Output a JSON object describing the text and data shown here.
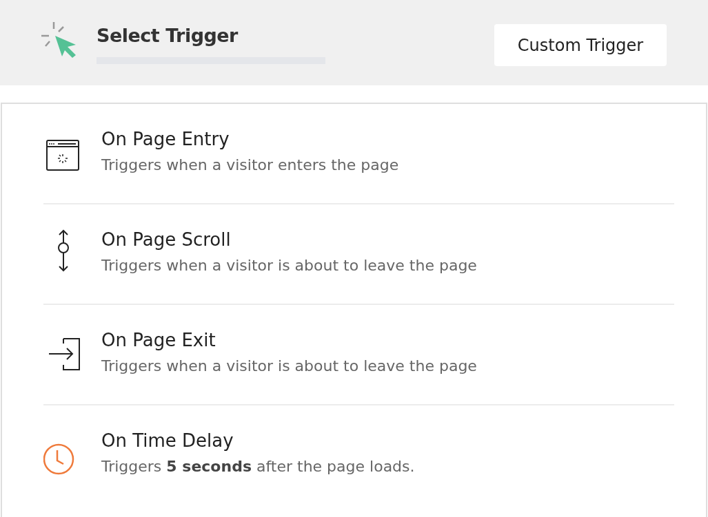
{
  "header": {
    "title": "Select Trigger",
    "button": "Custom Trigger"
  },
  "triggers": [
    {
      "kind": "entry",
      "title": "On Page Entry",
      "description": "Triggers when a visitor enters the page"
    },
    {
      "kind": "scroll",
      "title": "On Page Scroll",
      "description": "Triggers when a visitor is about to leave the page"
    },
    {
      "kind": "exit",
      "title": "On Page Exit",
      "description": "Triggers when a visitor is about to leave the page"
    },
    {
      "kind": "delay",
      "title": "On Time Delay",
      "description": "Triggers **5 seconds** after the page loads."
    }
  ]
}
